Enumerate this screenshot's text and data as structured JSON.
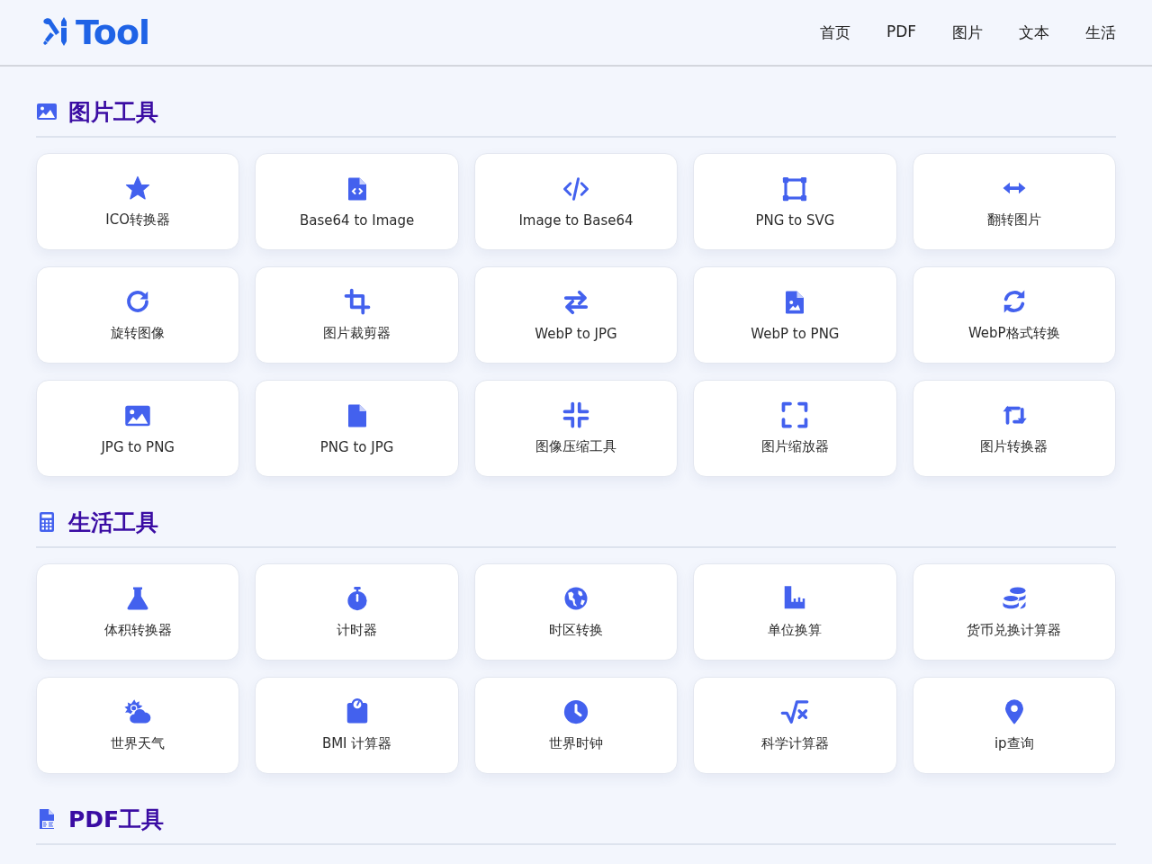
{
  "header": {
    "logo_text": "Tool",
    "nav": [
      {
        "label": "首页"
      },
      {
        "label": "PDF"
      },
      {
        "label": "图片"
      },
      {
        "label": "文本"
      },
      {
        "label": "生活"
      }
    ]
  },
  "sections": [
    {
      "title": "图片工具",
      "tools": [
        {
          "label": "ICO转换器"
        },
        {
          "label": "Base64 to Image"
        },
        {
          "label": "Image to Base64"
        },
        {
          "label": "PNG to SVG"
        },
        {
          "label": "翻转图片"
        },
        {
          "label": "旋转图像"
        },
        {
          "label": "图片裁剪器"
        },
        {
          "label": "WebP to JPG"
        },
        {
          "label": "WebP to PNG"
        },
        {
          "label": "WebP格式转换"
        },
        {
          "label": "JPG to PNG"
        },
        {
          "label": "PNG to JPG"
        },
        {
          "label": "图像压缩工具"
        },
        {
          "label": "图片缩放器"
        },
        {
          "label": "图片转换器"
        }
      ]
    },
    {
      "title": "生活工具",
      "tools": [
        {
          "label": "体积转换器"
        },
        {
          "label": "计时器"
        },
        {
          "label": "时区转换"
        },
        {
          "label": "单位换算"
        },
        {
          "label": "货币兑换计算器"
        },
        {
          "label": "世界天气"
        },
        {
          "label": "BMI 计算器"
        },
        {
          "label": "世界时钟"
        },
        {
          "label": "科学计算器"
        },
        {
          "label": "ip查询"
        }
      ]
    },
    {
      "title": "PDF工具"
    }
  ]
}
